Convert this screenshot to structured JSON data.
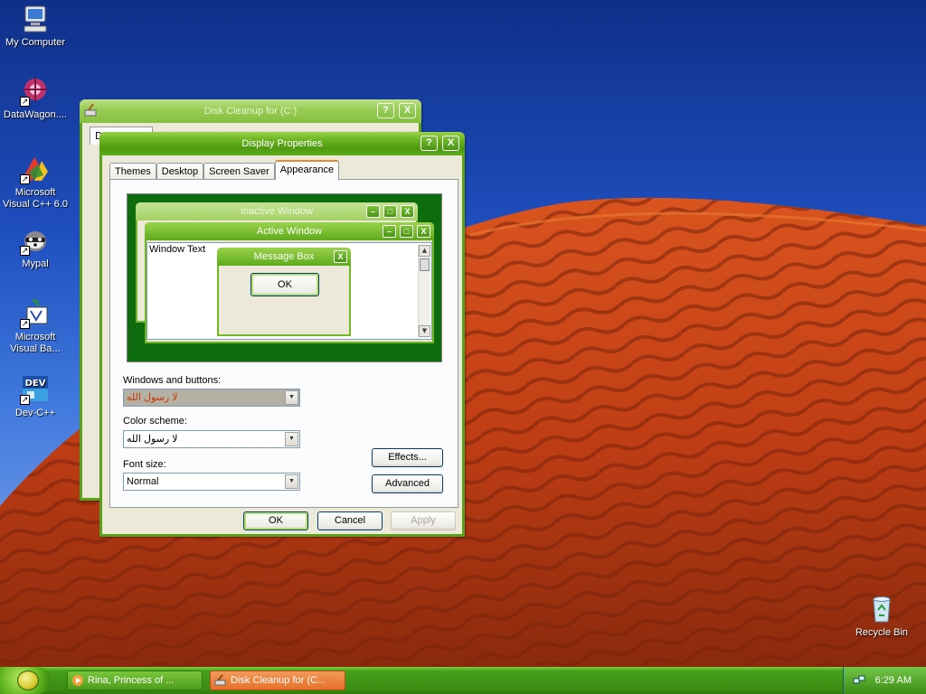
{
  "desktop": {
    "icons": [
      {
        "label": "My Computer",
        "icon": "computer-icon"
      },
      {
        "label": "DataWagon....",
        "icon": "datawagon-icon"
      },
      {
        "label": "Microsoft Visual C++ 6.0",
        "icon": "visual-cpp-icon"
      },
      {
        "label": "Mypal",
        "icon": "mypal-icon"
      },
      {
        "label": "Microsoft Visual Ba...",
        "icon": "visual-basic-icon"
      },
      {
        "label": "Dev-C++",
        "icon": "dev-cpp-icon"
      },
      {
        "label": "Recycle Bin",
        "icon": "recycle-bin-icon"
      }
    ],
    "dev_icon_text": "DEV"
  },
  "disk_cleanup": {
    "title": "Disk Cleanup for  (C:)",
    "help_glyph": "?",
    "close_glyph": "X",
    "partial_tab": "D"
  },
  "display_properties": {
    "title": "Display Properties",
    "help_glyph": "?",
    "close_glyph": "X",
    "tabs": [
      "Themes",
      "Desktop",
      "Screen Saver",
      "Appearance"
    ],
    "selected_tab": "Appearance",
    "preview": {
      "inactive_title": "Inactive Window",
      "active_title": "Active Window",
      "window_text": "Window Text",
      "message_title": "Message Box",
      "ok_label": "OK",
      "minimize_glyph": "–",
      "maximize_glyph": "□",
      "close_glyph": "X",
      "scroll_up_glyph": "▲",
      "scroll_down_glyph": "▼"
    },
    "windows_buttons_label": "Windows and buttons:",
    "windows_buttons_value": "لا رسول الله",
    "color_scheme_label": "Color scheme:",
    "color_scheme_value": "لا رسول الله",
    "font_size_label": "Font size:",
    "font_size_value": "Normal",
    "dropdown_glyph": "▼",
    "effects_label": "Effects...",
    "advanced_label": "Advanced",
    "ok_label": "OK",
    "cancel_label": "Cancel",
    "apply_label": "Apply"
  },
  "taskbar": {
    "buttons": [
      {
        "label": "Rina, Princess of ...",
        "icon": "media-player-icon",
        "active": false
      },
      {
        "label": "Disk Cleanup for  (C...",
        "icon": "disk-cleanup-icon",
        "active": true
      }
    ],
    "clock": "6:29 AM"
  },
  "colors": {
    "theme_green": "#5aa01a",
    "sky_blue": "#1f4fbf",
    "dune_red": "#c8401a",
    "active_task_orange": "#e5702a"
  }
}
